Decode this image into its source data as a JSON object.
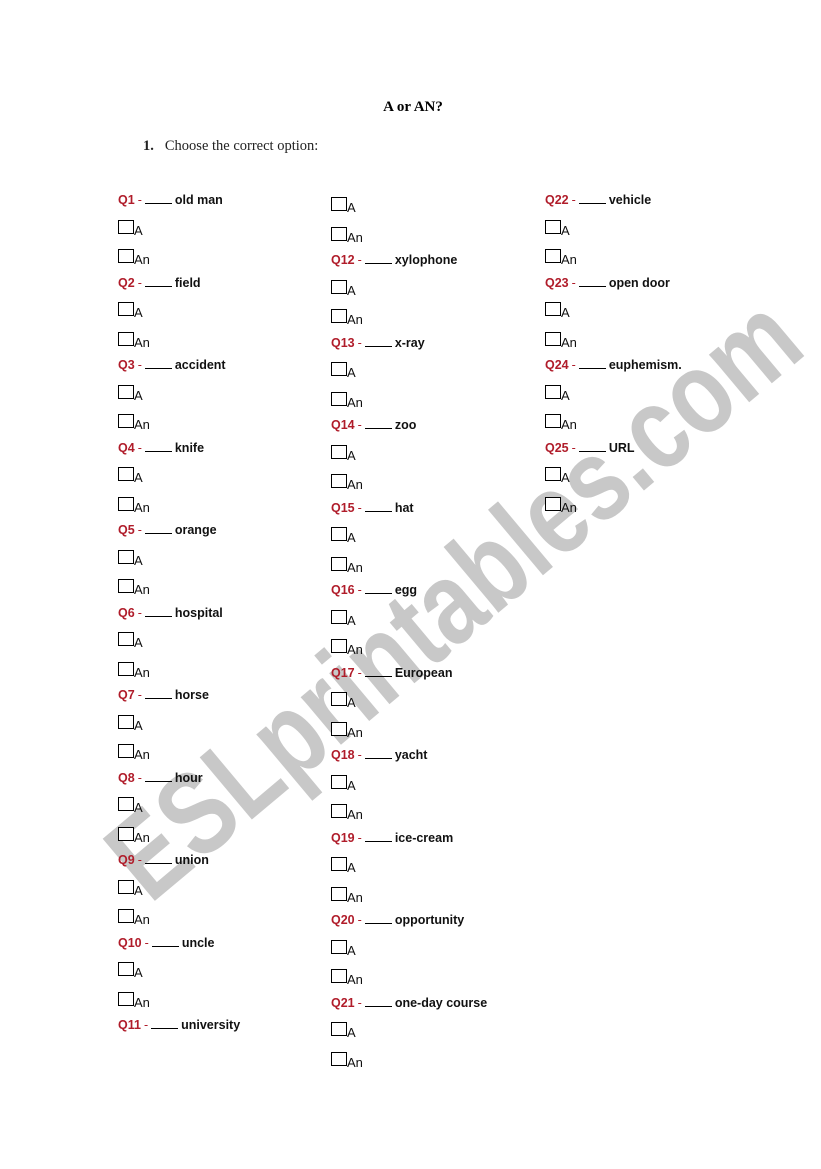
{
  "page": {
    "title": "A or AN?",
    "instruction_number": "1.",
    "instruction_text": "Choose the correct option:",
    "watermark_text": "ESLprintables.com",
    "accent_color": "#b01c2a",
    "watermark_color": "#c8c8c8"
  },
  "option_labels": {
    "a": "A",
    "an": "An"
  },
  "questions": [
    {
      "id": "Q1",
      "dash": "-",
      "word": "old man"
    },
    {
      "id": "Q2",
      "dash": "-",
      "word": "field"
    },
    {
      "id": "Q3",
      "dash": "-",
      "word": "accident"
    },
    {
      "id": "Q4",
      "dash": "-",
      "word": "knife"
    },
    {
      "id": "Q5",
      "dash": "-",
      "word": "orange"
    },
    {
      "id": "Q6",
      "dash": "-",
      "word": "hospital"
    },
    {
      "id": "Q7",
      "dash": "-",
      "word": "horse"
    },
    {
      "id": "Q8",
      "dash": "-",
      "word": "hour"
    },
    {
      "id": "Q9",
      "dash": "-",
      "word": "union"
    },
    {
      "id": "Q10",
      "dash": "-",
      "word": "uncle"
    },
    {
      "id": "Q11",
      "dash": "-",
      "word": "university"
    },
    {
      "id": "Q12",
      "dash": "-",
      "word": "xylophone"
    },
    {
      "id": "Q13",
      "dash": "-",
      "word": "x-ray"
    },
    {
      "id": "Q14",
      "dash": "-",
      "word": "zoo"
    },
    {
      "id": "Q15",
      "dash": "-",
      "word": "hat"
    },
    {
      "id": "Q16",
      "dash": "-",
      "word": "egg"
    },
    {
      "id": "Q17",
      "dash": "-",
      "word": "European"
    },
    {
      "id": "Q18",
      "dash": "-",
      "word": "yacht"
    },
    {
      "id": "Q19",
      "dash": "-",
      "word": "ice-cream"
    },
    {
      "id": "Q20",
      "dash": "-",
      "word": "opportunity"
    },
    {
      "id": "Q21",
      "dash": "-",
      "word": "one-day course"
    },
    {
      "id": "Q22",
      "dash": "-",
      "word": "vehicle"
    },
    {
      "id": "Q23",
      "dash": "-",
      "word": "open door"
    },
    {
      "id": "Q24",
      "dash": "-",
      "word": "euphemism."
    },
    {
      "id": "Q25",
      "dash": "-",
      "word": "URL"
    }
  ]
}
